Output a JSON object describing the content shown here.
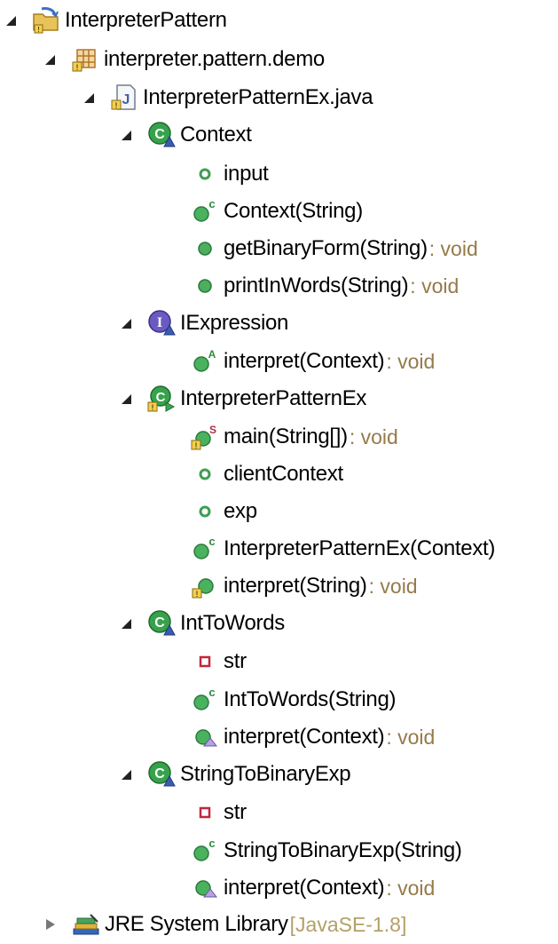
{
  "tree": {
    "project": {
      "label": "InterpreterPattern"
    },
    "package": {
      "label": "interpreter.pattern.demo"
    },
    "file": {
      "label": "InterpreterPatternEx.java"
    },
    "context": {
      "label": "Context",
      "members": [
        "input",
        "Context(String)",
        "getBinaryForm(String)",
        "printInWords(String)"
      ],
      "decorations": [
        "",
        "",
        ": void",
        ": void"
      ]
    },
    "iexpression": {
      "label": "IExpression",
      "members": [
        "interpret(Context)"
      ],
      "decorations": [
        ": void"
      ]
    },
    "interpreterPatternEx": {
      "label": "InterpreterPatternEx",
      "members": [
        "main(String[])",
        "clientContext",
        "exp",
        "InterpreterPatternEx(Context)",
        "interpret(String)"
      ],
      "decorations": [
        ": void",
        "",
        "",
        "",
        ": void"
      ]
    },
    "intToWords": {
      "label": "IntToWords",
      "members": [
        "str",
        "IntToWords(String)",
        "interpret(Context)"
      ],
      "decorations": [
        "",
        "",
        ": void"
      ]
    },
    "stringToBinaryExp": {
      "label": "StringToBinaryExp",
      "members": [
        "str",
        "StringToBinaryExp(String)",
        "interpret(Context)"
      ],
      "decorations": [
        "",
        "",
        ": void"
      ]
    },
    "jre": {
      "label": "JRE System Library",
      "decoration": "[JavaSE-1.8]"
    }
  },
  "colors": {
    "public_method": "#3f9d52",
    "private_field": "#c0283b",
    "class": "#2a8a3c",
    "interface": "#5b4ca8",
    "decoration": "#957a4a"
  }
}
